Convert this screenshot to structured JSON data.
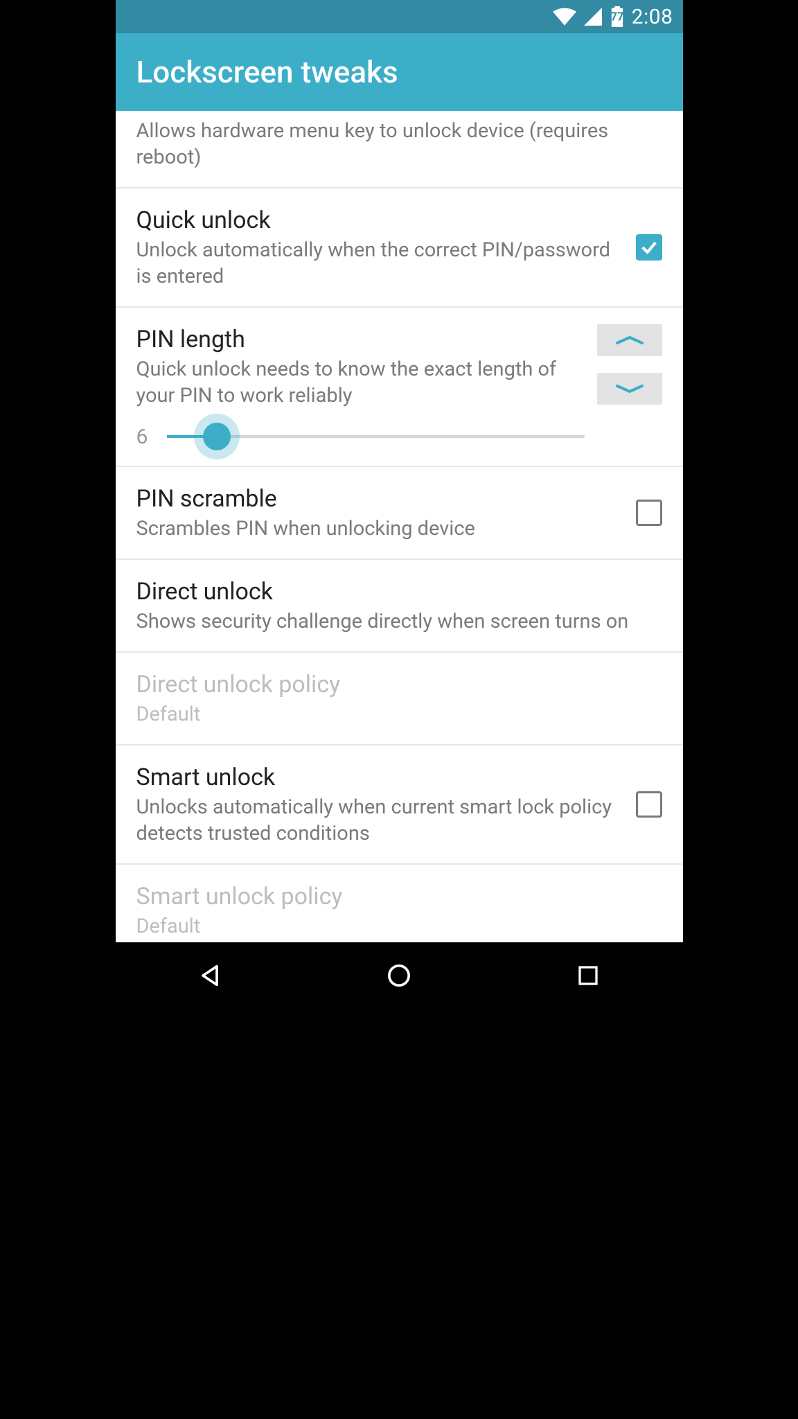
{
  "status": {
    "time": "2:08",
    "battery_pct": "77"
  },
  "header": {
    "title": "Lockscreen tweaks"
  },
  "rows": {
    "menu_key": {
      "subtitle": "Allows hardware menu key to unlock device (requires reboot)"
    },
    "quick_unlock": {
      "title": "Quick unlock",
      "subtitle": "Unlock automatically when the correct PIN/password is entered",
      "checked": true
    },
    "pin_length": {
      "title": "PIN length",
      "subtitle": "Quick unlock needs to know the exact length of your PIN to work reliably",
      "value": "6"
    },
    "pin_scramble": {
      "title": "PIN scramble",
      "subtitle": "Scrambles PIN when unlocking device",
      "checked": false
    },
    "direct_unlock": {
      "title": "Direct unlock",
      "subtitle": "Shows security challenge directly when screen turns on"
    },
    "direct_unlock_policy": {
      "title": "Direct unlock policy",
      "value": "Default"
    },
    "smart_unlock": {
      "title": "Smart unlock",
      "subtitle": "Unlocks automatically when current smart lock policy detects trusted conditions",
      "checked": false
    },
    "smart_unlock_policy": {
      "title": "Smart unlock policy",
      "value": "Default"
    }
  }
}
